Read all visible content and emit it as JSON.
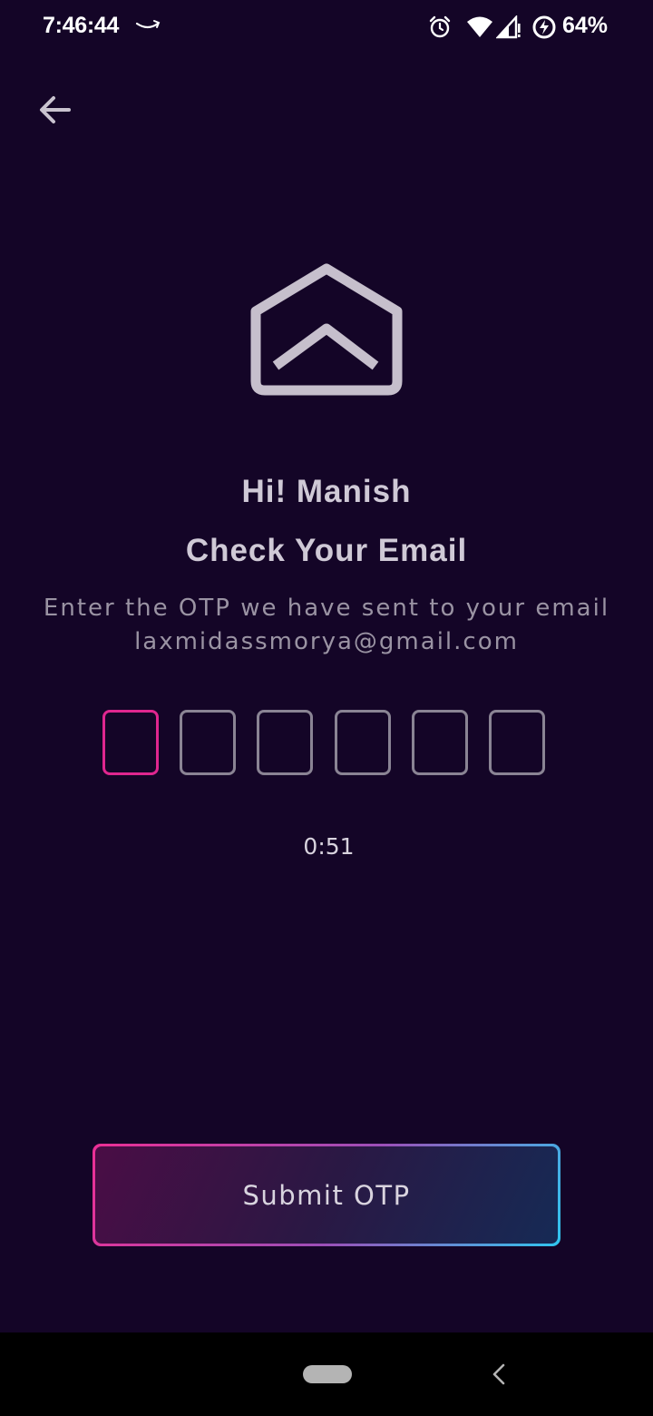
{
  "status_bar": {
    "time": "7:46:44",
    "battery_percent": "64%",
    "icons": [
      "amazon-icon",
      "alarm-icon",
      "wifi-icon",
      "signal-icon",
      "battery-saver-icon"
    ]
  },
  "header": {
    "back_icon": "arrow-left-icon"
  },
  "main": {
    "illustration_icon": "open-envelope-icon",
    "greeting": "Hi! Manish",
    "title": "Check Your Email",
    "instruction_line1": "Enter the OTP we have sent to your email",
    "email": "laxmidassmorya@gmail.com",
    "otp": {
      "length": 6,
      "values": [
        "",
        "",
        "",
        "",
        "",
        ""
      ],
      "active_index": 0
    },
    "timer": "0:51"
  },
  "submit_button": {
    "label": "Submit OTP"
  },
  "colors": {
    "background": "#140527",
    "text_primary": "#cfc9d6",
    "text_muted": "#9a93a3",
    "otp_active_border": "#e0268f",
    "otp_border": "#8a8494",
    "gradient_pink": "#ec2f95",
    "gradient_cyan": "#2fc6ef"
  },
  "nav_bar": {
    "icons": [
      "home-pill",
      "chevron-left-icon"
    ]
  }
}
